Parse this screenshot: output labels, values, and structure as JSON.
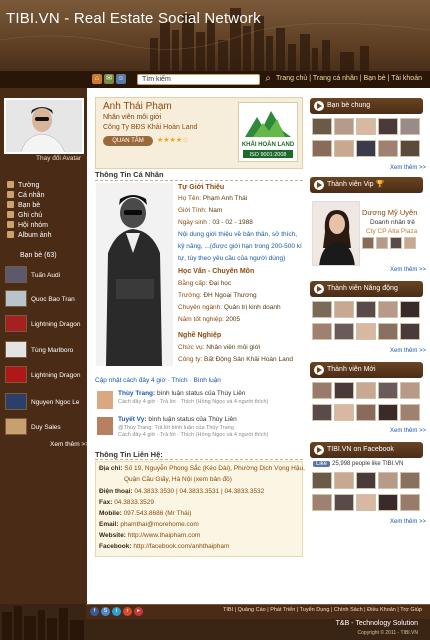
{
  "header": {
    "title": "TIBI.VN - Real Estate Social Network",
    "search_placeholder": "Tìm kiếm",
    "nav": [
      "Trang chủ",
      "Trang cá nhân",
      "Bạn bè",
      "Tài khoản"
    ]
  },
  "left": {
    "avatar_caption": "Thay đổi Avatar",
    "nav": [
      "Tường",
      "Cá nhân",
      "Bạn bè",
      "Ghi chú",
      "Hội nhóm",
      "Album ảnh"
    ],
    "friends_title": "Bạn bè (63)",
    "friends": [
      "Tuấn Audi",
      "Quoc Bao Tran",
      "Lightning Dragon",
      "Tùng Marlboro",
      "Lightning Dragon",
      "Nguyen Ngoc Le",
      "Duy Sales"
    ],
    "more": "Xem thêm >>"
  },
  "profile": {
    "name": "Anh Thái Phạm",
    "title": "Nhân viên môi giới",
    "company": "Công Ty BĐS Khải Hoàn Land",
    "follow": "QUAN TÂM",
    "stars": "★★★★☆",
    "logo_text": "KHẢI HOÀN LAND",
    "logo_iso": "ISO 9001:2008"
  },
  "personal": {
    "section_title": "Thông Tin Cá Nhân",
    "intro_head": "Tự Giới Thiệu",
    "name_label": "Họ Tên:",
    "name_value": "Phạm Anh Thái",
    "gender_label": "Giới Tính:",
    "gender_value": "Nam",
    "dob_label": "Ngày sinh :",
    "dob_value": "03 - 02 - 1988",
    "intro_text": "Nội dung giới thiệu về bản thân, sở thích, kỹ năng, ...(được giới hạn trong 200-500 kí tự, tùy theo yêu cầu của người dùng)",
    "edu_head": "Học Vấn - Chuyên Môn",
    "degree_label": "Bằng cấp:",
    "degree_value": "Đại học",
    "school_label": "Trường:",
    "school_value": "ĐH Ngoại Thương",
    "major_label": "Chuyên ngành:",
    "major_value": "Quản trị kinh doanh",
    "grad_label": "Năm tốt nghiệp:",
    "grad_value": "2005",
    "job_head": "Nghề Nghiệp",
    "pos_label": "Chức vụ:",
    "pos_value": "Nhân viên môi giới",
    "comp_label": "Công ty:",
    "comp_value": "Bất Động Sản Khải Hoàn Land"
  },
  "activity": {
    "bar": "Cập nhật cách đây 4 giờ · Thích · Bình luận",
    "items": [
      {
        "user": "Thùy Trang:",
        "text": " bình luận status của Thùy Liên",
        "meta": "Cách đây 4 giờ  ·  Trả lời  ·  Thích (Hồng Ngọc và 4 người thích)"
      },
      {
        "user": "Tuyết Vy:",
        "text": " bình luận status của Thùy Liên",
        "meta": "@Thùy Trang: Trả lời bình luận của Thùy Trang",
        "meta2": "Cách đây 4 giờ  ·  Trả lời  ·  Thích (Hồng Ngọc và 4 người thích)"
      }
    ]
  },
  "contact": {
    "section_title": "Thông Tin Liên Hệ:",
    "addr_label": "Địa chỉ:",
    "addr_value": "Số 19, Nguyễn Phong Sắc (Kéo Dài), Phường Dịch Vọng Hậu,",
    "addr_value2": "Quận Cầu Giấy, Hà Nội (xem bản đồ)",
    "phone_label": "Điện thoại:",
    "phone_value": "04.3833.3530  |  04.3833.3531  |  04.3833.3532",
    "fax_label": "Fax:",
    "fax_value": "04.3833.3529",
    "mobile_label": "Mobile:",
    "mobile_value": "097.543.8686 (Mr Thái)",
    "email_label": "Email:",
    "email_value": "phamthai@morehome.com",
    "web_label": "Website:",
    "web_value": "http://www.thaipham.com",
    "fb_label": "Facebook:",
    "fb_value": "http://facebook.com/anhthaipham"
  },
  "right": {
    "common_title": "Bạn bè chung",
    "vip_title": "Thành viên Vip",
    "vip_name": "Dương Mỹ Uyên",
    "vip_role": "Doanh nhân trẻ",
    "vip_company": "Cty CP Alta Plaza",
    "active_title": "Thành viên Năng động",
    "new_title": "Thành viên Mới",
    "fb_title": "TIBI.VN on Facebook",
    "fb_like": "Like",
    "fb_count": "25,998 people like TIBI.VN",
    "more": "Xem thêm >>"
  },
  "footer": {
    "links": "TIBI | Quảng Cáo | Phát Triển | Tuyển Dụng | Chính Sách | Điều Khoản | Trợ Giúp",
    "brand": "T&B - Technology Solution",
    "copyright": "Copyright © 2011 - TIBI.VN"
  },
  "colors": {
    "header_brown": "#5c3d22",
    "sidebar_brown": "#4a2c16",
    "accent_brown": "#8a4a0d",
    "link_blue": "#1a57a8"
  }
}
